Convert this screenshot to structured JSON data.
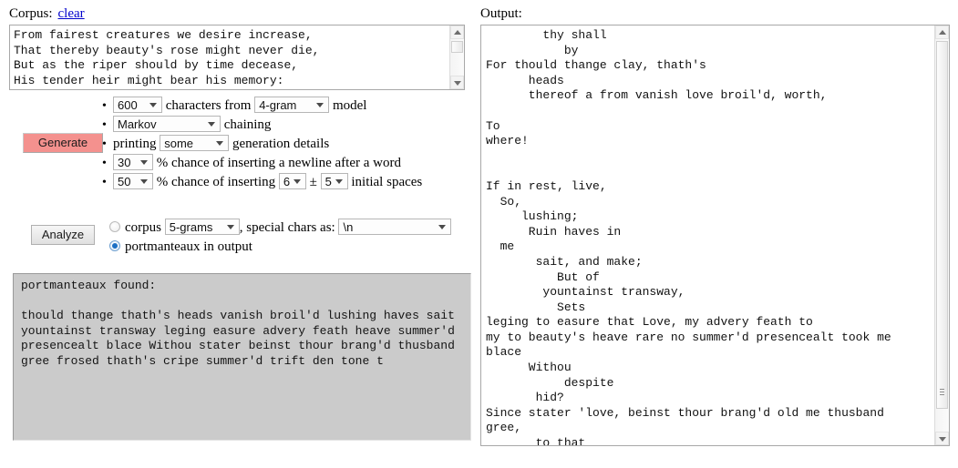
{
  "corpus": {
    "label": "Corpus:",
    "clear_link": "clear",
    "text": "From fairest creatures we desire increase,\nThat thereby beauty's rose might never die,\nBut as the riper should by time decease,\nHis tender heir might bear his memory:"
  },
  "generate": {
    "button_label": "Generate",
    "line1": {
      "count": "600",
      "text_mid": "characters from",
      "model": "4-gram",
      "text_end": "model"
    },
    "line2": {
      "chaining_mode": "Markov",
      "text_end": "chaining"
    },
    "line3": {
      "text_start": "printing",
      "detail_level": "some",
      "text_end": "generation details"
    },
    "line4": {
      "percent": "30",
      "text_end": "% chance of inserting a newline after a word"
    },
    "line5": {
      "percent": "50",
      "text_mid": "% chance of inserting",
      "spaces": "6",
      "plusminus": "±",
      "variance": "5",
      "text_end": "initial spaces"
    }
  },
  "analyze": {
    "button_label": "Analyze",
    "option_corpus": {
      "selected": false,
      "label": "corpus",
      "ngram": "5-grams",
      "text_mid": ", special chars as:",
      "special_chars": "\\n"
    },
    "option_portmanteaux": {
      "selected": true,
      "label": "portmanteaux in output"
    }
  },
  "portmanteaux_panel": {
    "text": "portmanteaux found:\n\nthould thange thath's heads vanish broil'd lushing haves sait yountainst transway leging easure advery feath heave summer'd presencealt blace Withou stater beinst thour brang'd thusband gree frosed thath's cripe summer'd trift den tone t"
  },
  "output": {
    "label": "Output:",
    "text": "        thy shall\n           by\nFor thould thange clay, thath's\n      heads\n      thereof a from vanish love broil'd, worth,\n\nTo\nwhere!\n\n\nIf in rest, live,\n  So,\n     lushing;\n      Ruin haves in\n  me\n       sait, and make;\n          But of\n        yountainst transway,\n          Sets\nleging to easure that Love, my advery feath to\nmy to beauty's heave rare no summer'd presencealt took me\nblace\n      Withou\n           despite\n       hid?\nSince stater 'love, beinst thour brang'd old me thusband\ngree,\n       to that"
  },
  "colors": {
    "generate_button_bg": "#f4918e",
    "panel_bg": "#cbcbcb",
    "link": "#0000cc",
    "radio_selected": "#1c6fc4"
  }
}
